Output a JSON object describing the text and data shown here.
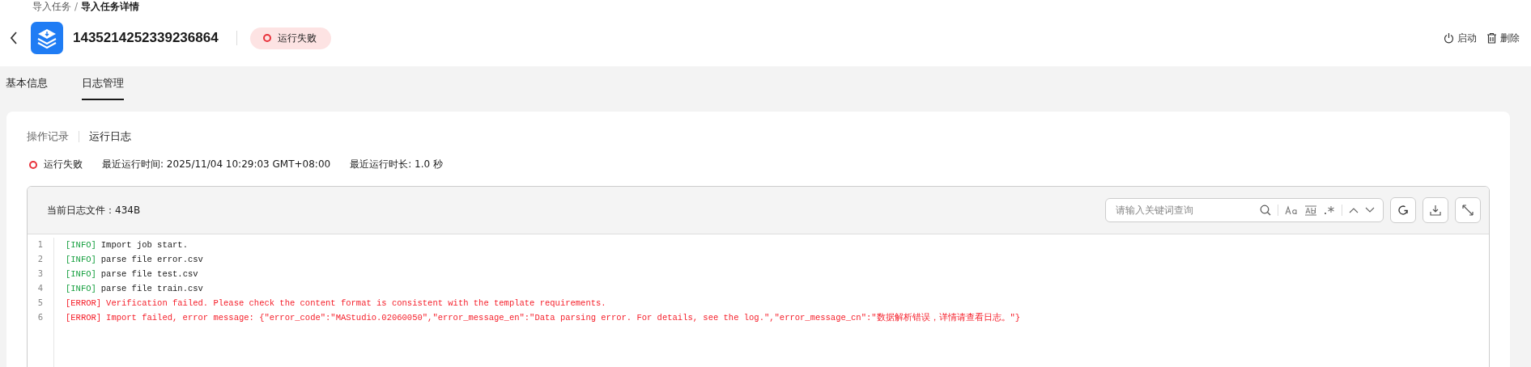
{
  "breadcrumb": {
    "separator": "/",
    "items": [
      {
        "label": "导入任务",
        "current": false
      },
      {
        "label": "导入任务详情",
        "current": true
      }
    ]
  },
  "header": {
    "title": "1435214252339236864",
    "status": {
      "label": "运行失败",
      "color": "#e8313a"
    },
    "actions": [
      {
        "kind": "start",
        "label": "启动"
      },
      {
        "kind": "delete",
        "label": "删除"
      }
    ]
  },
  "tabs": [
    {
      "label": "基本信息",
      "selected": false
    },
    {
      "label": "日志管理",
      "selected": true
    }
  ],
  "log_tabs": [
    {
      "label": "操作记录",
      "selected": false
    },
    {
      "label": "运行日志",
      "selected": true
    }
  ],
  "run_info": {
    "status": {
      "label": "运行失败",
      "color": "#e8313a"
    },
    "last_run_time": "最近运行时间: 2025/11/04 10:29:03 GMT+08:00",
    "last_duration": "最近运行时长: 1.0 秒"
  },
  "log_viewer": {
    "file_label": "当前日志文件：434B",
    "search": {
      "placeholder": "请输入关键词查询"
    },
    "lines": [
      {
        "number": "1",
        "kind": "info",
        "tag": "[INFO]",
        "text": "Import job start."
      },
      {
        "number": "2",
        "kind": "info",
        "tag": "[INFO]",
        "text": "parse file error.csv"
      },
      {
        "number": "3",
        "kind": "info",
        "tag": "[INFO]",
        "text": "parse file test.csv"
      },
      {
        "number": "4",
        "kind": "info",
        "tag": "[INFO]",
        "text": "parse file train.csv"
      },
      {
        "number": "5",
        "kind": "error",
        "tag": "[ERROR]",
        "text": "Verification failed. Please check the content format is consistent with the template requirements."
      },
      {
        "number": "6",
        "kind": "error",
        "tag": "[ERROR]",
        "text": "Import failed, error message: {\"error_code\":\"MAStudio.02060050\",\"error_message_en\":\"Data parsing error. For details, see the log.\",\"error_message_cn\":\"数据解析错误，详情请查看日志。\"}"
      }
    ]
  }
}
